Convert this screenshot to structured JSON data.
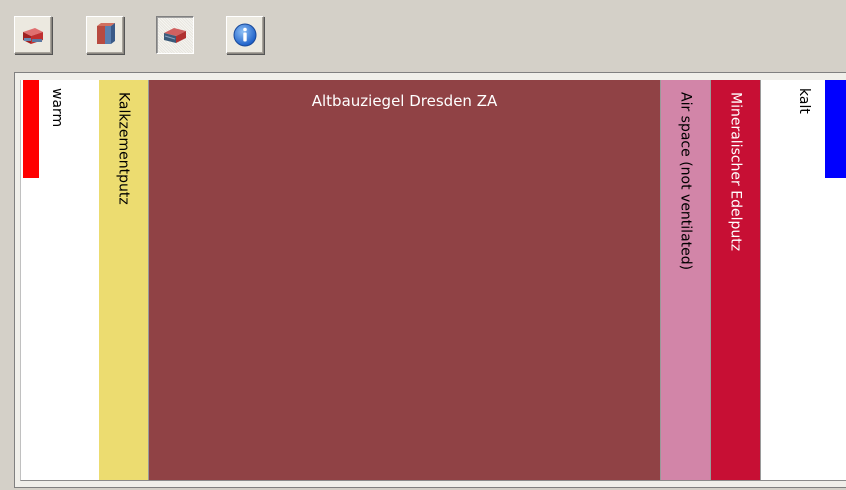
{
  "toolbar": {
    "buttons": [
      {
        "name": "construction-view-icon",
        "pressed": false
      },
      {
        "name": "layer-materials-icon",
        "pressed": false
      },
      {
        "name": "3d-wall-view-icon",
        "pressed": true
      },
      {
        "name": "info-icon",
        "pressed": false
      }
    ]
  },
  "assembly": {
    "warm_side": {
      "label": "warm",
      "color": "#ff0000"
    },
    "cold_side": {
      "label": "kalt",
      "color": "#0000ff"
    },
    "layers": [
      {
        "name": "Kalkzementputz",
        "color": "#ecdc70",
        "text_color": "#000000"
      },
      {
        "name": "Altbauziegel Dresden ZA",
        "color": "#904245",
        "text_color": "#ffffff"
      },
      {
        "name": "Air space (not ventilated)",
        "color": "#d285a8",
        "text_color": "#000000"
      },
      {
        "name": "Mineralischer Edelputz",
        "color": "#c70f34",
        "text_color": "#ffffff"
      }
    ]
  }
}
